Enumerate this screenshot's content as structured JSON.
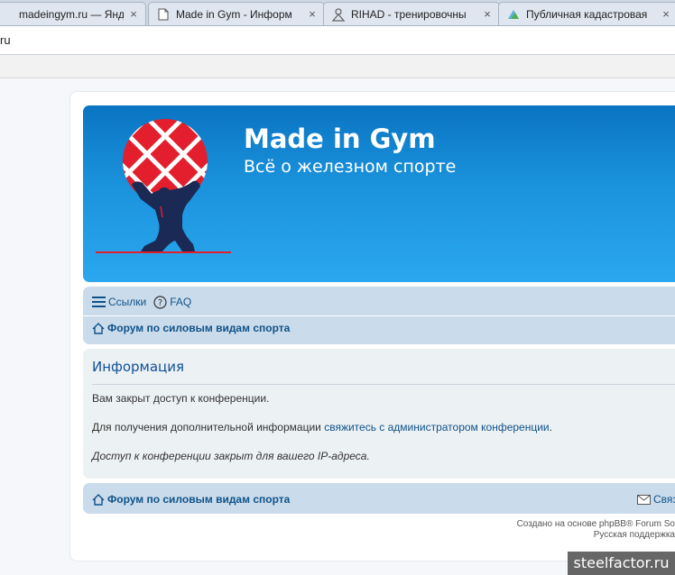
{
  "browser": {
    "tabs": [
      {
        "title": "madeingym.ru — Яндекс",
        "icon": "yandex-icon",
        "active": false
      },
      {
        "title": "Made in Gym - Информ",
        "icon": "page-icon",
        "active": true
      },
      {
        "title": "RIHAD - тренировочны",
        "icon": "rihad-icon",
        "active": false
      },
      {
        "title": "Публичная кадастровая",
        "icon": "map-icon",
        "active": false
      }
    ],
    "close_glyph": "×",
    "address": "ru"
  },
  "site": {
    "title": "Made in Gym",
    "description": "Всё о железном спорте",
    "header_color_top": "#0a74c2",
    "header_color_bottom": "#2aa7ef"
  },
  "nav": {
    "links_label": "Ссылки",
    "faq_label": "FAQ",
    "breadcrumb": "Форум по силовым видам спорта"
  },
  "info": {
    "heading": "Информация",
    "line1": "Вам закрыт доступ к конференции.",
    "line2_before": "Для получения дополнительной информации ",
    "line2_link": "свяжитесь с администратором конференции",
    "line2_after": ".",
    "line3": "Доступ к конференции закрыт для вашего IP-адреса."
  },
  "footer": {
    "breadcrumb": "Форум по силовым видам спорта",
    "contact_label": "Связ",
    "powered_by": "Создано на основе phpBB® Forum So",
    "support": "Русская поддержка"
  },
  "watermark": "steelfactor.ru"
}
